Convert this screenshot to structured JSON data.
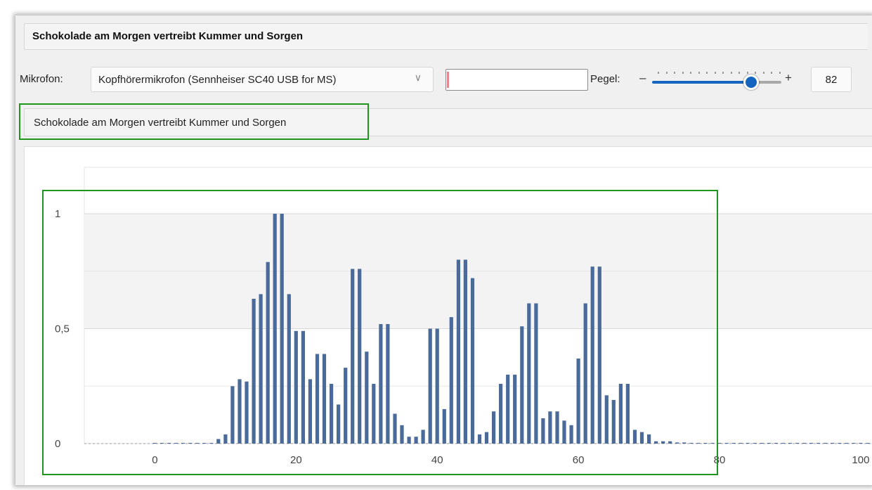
{
  "window": {
    "title": "Schokolade am Morgen vertreibt Kummer und Sorgen"
  },
  "toolbar": {
    "mic_label": "Mikrofon:",
    "mic_value": "Kopfhörermikrofon (Sennheiser SC40 USB for MS)",
    "level_field_value": "",
    "pegel_label": "Pegel:",
    "minus": "–",
    "plus": "+",
    "gain_value": "82",
    "gain_fraction": 0.82
  },
  "recognized_text": "Schokolade am Morgen vertreibt Kummer und Sorgen",
  "colors": {
    "bar": "#4a6a9a",
    "highlight": "#1e961e",
    "accent": "#1565c0"
  },
  "icons": {
    "dropdown": "chevron-down-icon"
  },
  "chart_data": {
    "type": "bar",
    "title": "",
    "xlabel": "",
    "ylabel": "",
    "xlim": [
      -10,
      102
    ],
    "ylim": [
      0,
      1
    ],
    "grid": true,
    "x_ticks": [
      "0",
      "20",
      "40",
      "60",
      "80",
      "100"
    ],
    "x_tick_values": [
      0,
      20,
      40,
      60,
      80,
      100
    ],
    "y_ticks": [
      "0",
      "0,5",
      "1"
    ],
    "y_tick_values": [
      0,
      0.5,
      1
    ],
    "x": [
      0,
      1,
      2,
      3,
      4,
      5,
      6,
      7,
      8,
      9,
      10,
      11,
      12,
      13,
      14,
      15,
      16,
      17,
      18,
      19,
      20,
      21,
      22,
      23,
      24,
      25,
      26,
      27,
      28,
      29,
      30,
      31,
      32,
      33,
      34,
      35,
      36,
      37,
      38,
      39,
      40,
      41,
      42,
      43,
      44,
      45,
      46,
      47,
      48,
      49,
      50,
      51,
      52,
      53,
      54,
      55,
      56,
      57,
      58,
      59,
      60,
      61,
      62,
      63,
      64,
      65,
      66,
      67,
      68,
      69,
      70,
      71,
      72,
      73,
      74,
      75,
      76,
      77,
      78,
      79,
      80,
      81,
      82,
      83,
      84,
      85,
      86,
      87,
      88,
      89,
      90,
      91,
      92,
      93,
      94,
      95,
      96,
      97,
      98,
      99,
      100,
      101,
      102
    ],
    "values": [
      0.003,
      0.003,
      0.003,
      0.003,
      0.003,
      0.003,
      0.003,
      0.003,
      0.003,
      0.02,
      0.04,
      0.25,
      0.28,
      0.27,
      0.63,
      0.65,
      0.79,
      1.0,
      1.0,
      0.65,
      0.49,
      0.49,
      0.28,
      0.39,
      0.39,
      0.26,
      0.17,
      0.33,
      0.76,
      0.76,
      0.4,
      0.26,
      0.52,
      0.52,
      0.13,
      0.08,
      0.03,
      0.03,
      0.06,
      0.5,
      0.5,
      0.15,
      0.55,
      0.8,
      0.8,
      0.72,
      0.04,
      0.05,
      0.14,
      0.26,
      0.3,
      0.3,
      0.51,
      0.61,
      0.61,
      0.11,
      0.14,
      0.14,
      0.1,
      0.08,
      0.37,
      0.61,
      0.77,
      0.77,
      0.21,
      0.19,
      0.26,
      0.26,
      0.06,
      0.05,
      0.04,
      0.01,
      0.01,
      0.01,
      0.005,
      0.005,
      0.003,
      0.003,
      0.003,
      0.003,
      0.003,
      0.003,
      0.003,
      0.003,
      0.003,
      0.003,
      0.003,
      0.003,
      0.003,
      0.003,
      0.003,
      0.003,
      0.003,
      0.003,
      0.003,
      0.003,
      0.003,
      0.003,
      0.003,
      0.003,
      0.003,
      0.003,
      0.003
    ]
  }
}
